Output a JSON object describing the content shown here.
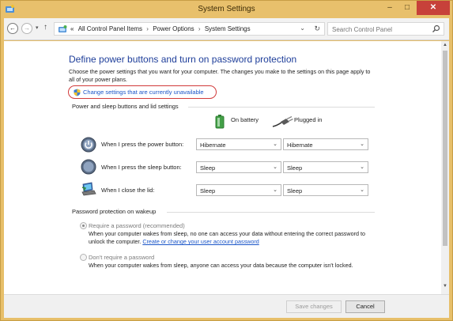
{
  "window": {
    "title": "System Settings",
    "controls": {
      "minimize": "–",
      "maximize": "□",
      "close": "✕"
    }
  },
  "address": {
    "back": "←",
    "forward": "→",
    "recent": "▾",
    "up": "↑",
    "overflow": "«",
    "crumbs": [
      "All Control Panel Items",
      "Power Options",
      "System Settings"
    ],
    "crumb_sep": "›",
    "dropdown": "⌄",
    "refresh": "↻",
    "search_placeholder": "Search Control Panel"
  },
  "main": {
    "heading": "Define power buttons and turn on password protection",
    "intro": "Choose the power settings that you want for your computer. The changes you make to the settings on this page apply to all of your power plans.",
    "change_link": "Change settings that are currently unavailable",
    "power_section": {
      "title": "Power and sleep buttons and lid settings",
      "col_battery": "On battery",
      "col_plugged": "Plugged in",
      "rows": [
        {
          "label": "When I press the power button:",
          "battery": "Hibernate",
          "plugged": "Hibernate"
        },
        {
          "label": "When I press the sleep button:",
          "battery": "Sleep",
          "plugged": "Sleep"
        },
        {
          "label": "When I close the lid:",
          "battery": "Sleep",
          "plugged": "Sleep"
        }
      ]
    },
    "password_section": {
      "title": "Password protection on wakeup",
      "require": {
        "label": "Require a password (recommended)",
        "desc": "When your computer wakes from sleep, no one can access your data without entering the correct password to unlock the computer.",
        "link": "Create or change your user account password",
        "checked": true
      },
      "no_require": {
        "label": "Don't require a password",
        "desc": "When your computer wakes from sleep, anyone can access your data because the computer isn't locked.",
        "checked": false
      }
    }
  },
  "footer": {
    "save": "Save changes",
    "cancel": "Cancel"
  },
  "colors": {
    "frame": "#e8c06c",
    "close": "#c7413a",
    "heading": "#1e3e9a",
    "link": "#1a55c8",
    "highlight_ring": "#d13a3a"
  }
}
